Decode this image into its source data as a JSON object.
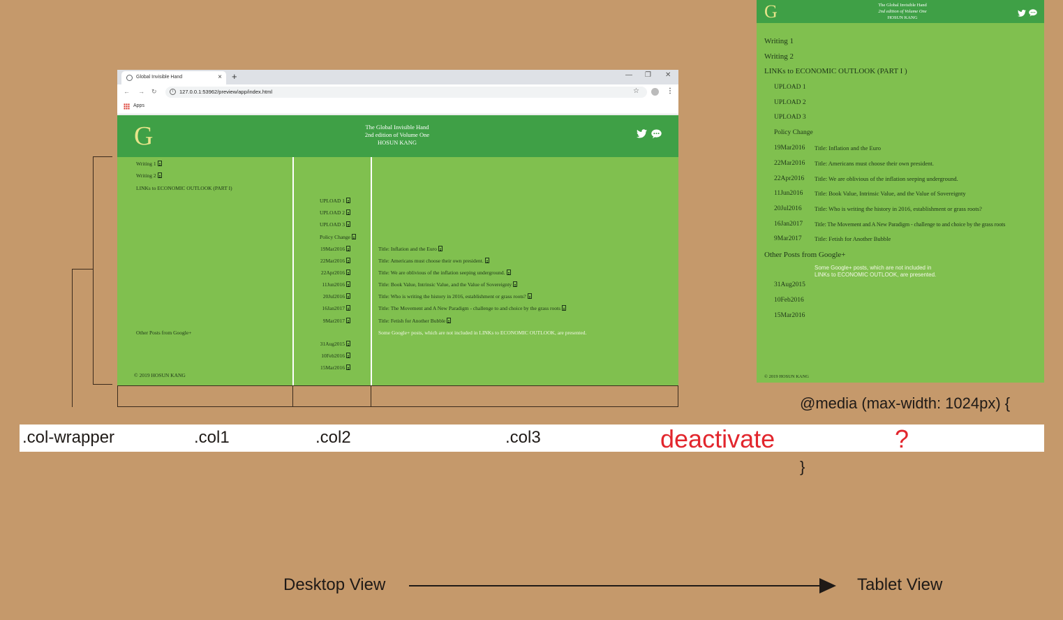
{
  "browser": {
    "tab_title": "Global Invisible Hand",
    "tab_close": "×",
    "new_tab": "+",
    "minimize": "—",
    "restore": "❐",
    "close": "✕",
    "back": "←",
    "forward": "→",
    "reload": "↻",
    "url": "127.0.0.1:53962/preview/app/index.html",
    "bookmark_star": "☆",
    "menu": "⋮",
    "apps_label": "Apps"
  },
  "site": {
    "logo": "G",
    "title_line1": "The Global Invisible Hand",
    "title_line2": "2nd edition of Volume One",
    "title_line3": "HOSUN KANG",
    "twitter_icon": "twitter-icon",
    "chat_icon": "chat-icon",
    "copyright": "© 2019 HOSUN KANG"
  },
  "col1": {
    "writing1": "Writing 1",
    "writing2": "Writing 2",
    "links": "LINKs to ECONOMIC OUTLOOK (PART I)",
    "other_posts": "Other Posts from Google+"
  },
  "col2": {
    "uploads": [
      "UPLOAD 1",
      "UPLOAD 2",
      "UPLOAD 3"
    ],
    "policy_change": "Policy Change",
    "dates": [
      "19Mar2016",
      "22Mar2016",
      "22Apr2016",
      "11Jun2016",
      "20Jul2016",
      "16Jan2017",
      "9Mar2017"
    ],
    "google_dates": [
      "31Aug2015",
      "10Feb2016",
      "15Mar2016"
    ]
  },
  "col3": {
    "titles": [
      "Title: Inflation and the Euro",
      "Title: Americans must choose their own president.",
      "Title: We are oblivious of the inflation seeping underground.",
      "Title: Book Value, Intrinsic Value, and the Value of Sovereignty",
      "Title: Who is writing the history in 2016, establishment or grass roots?",
      "Title: The Movement and A New Paradigm - challenge to and choice by the grass roots",
      "Title: Fetish for Another Bubble"
    ],
    "google_note": "Some Google+ posts, which are not included in LINKs to ECONOMIC OUTLOOK, are presented."
  },
  "tablet": {
    "writing1": "Writing 1",
    "writing2": "Writing 2",
    "links": "LINKs to ECONOMIC OUTLOOK (PART I )",
    "uploads": [
      "UPLOAD 1",
      "UPLOAD 2",
      "UPLOAD 3"
    ],
    "policy_change": "Policy Change",
    "dates": [
      "19Mar2016",
      "22Mar2016",
      "22Apr2016",
      "11Jun2016",
      "20Jul2016",
      "16Jan2017",
      "9Mar2017"
    ],
    "titles": [
      "Title: Inflation and the Euro",
      "Title: Americans must choose their own president.",
      "Title: We are oblivious of the inflation seeping underground.",
      "Title: Book Value, Intrinsic Value, and the Value of Sovereignty",
      "Title: Who is writing the history in 2016, establishment or grass roots?",
      "Title: The Movement and A New Paradigm - challenge to and choice by the grass roots"
    ],
    "title_last": "Title: Fetish for Another Bubble",
    "other_posts": "Other Posts from Google+",
    "note_line1": "Some Google+ posts, which are not included in",
    "note_line2": "LINKs to ECONOMIC OUTLOOK, are presented.",
    "google_dates": [
      "31Aug2015",
      "10Feb2016",
      "15Mar2016"
    ],
    "copyright": "© 2019 HOSUN KANG"
  },
  "annotations": {
    "col_wrapper": ".col-wrapper",
    "col1": ".col1",
    "col2": ".col2",
    "col3": ".col3",
    "deactivate": "deactivate",
    "question": "?",
    "media_open": "@media (max-width: 1024px) {",
    "media_close": "}",
    "desktop_view": "Desktop View",
    "tablet_view": "Tablet View"
  },
  "colors": {
    "background": "#c5996b",
    "header_green": "#3fa046",
    "body_green": "#80c04f",
    "logo_yellow": "#e7e48a",
    "highlight_red": "#e2262d"
  }
}
